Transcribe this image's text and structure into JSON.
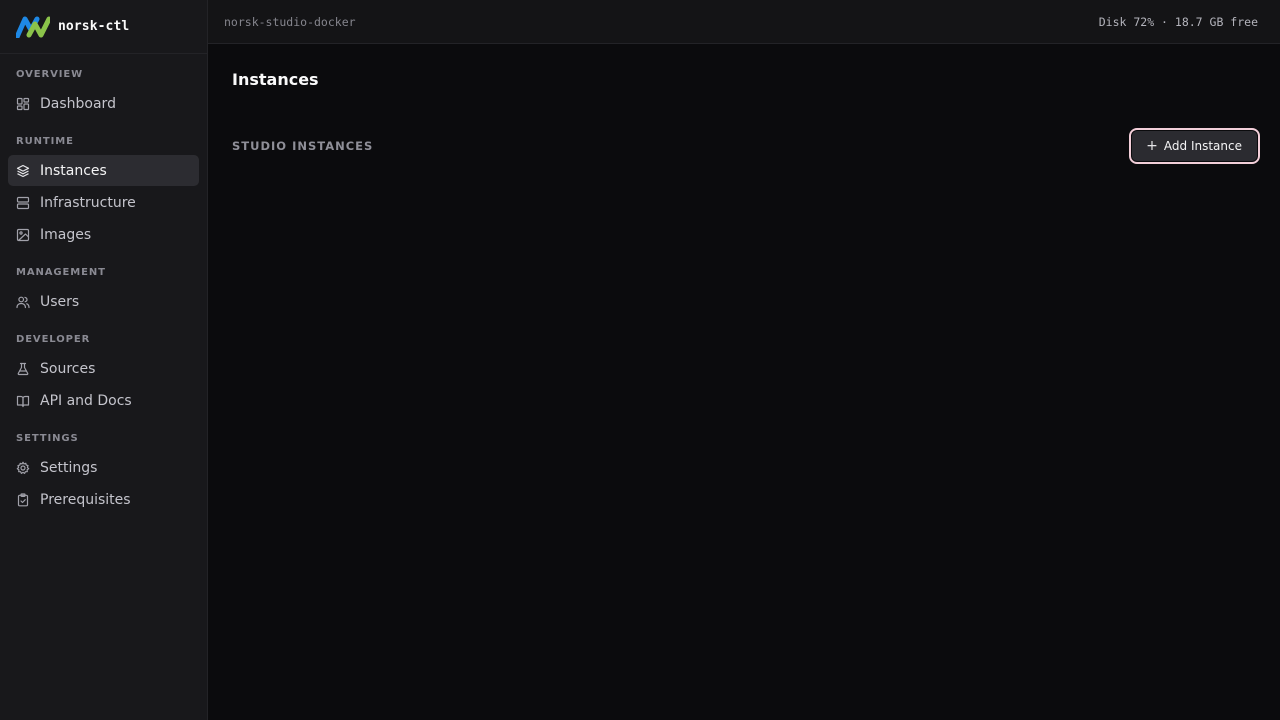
{
  "app": {
    "name": "norsk-ctl"
  },
  "sidebar": {
    "sections": [
      {
        "title": "OVERVIEW",
        "items": [
          {
            "label": "Dashboard",
            "icon": "dashboard-grid-icon",
            "active": false
          }
        ]
      },
      {
        "title": "RUNTIME",
        "items": [
          {
            "label": "Instances",
            "icon": "layers-icon",
            "active": true
          },
          {
            "label": "Infrastructure",
            "icon": "server-icon",
            "active": false
          },
          {
            "label": "Images",
            "icon": "image-icon",
            "active": false
          }
        ]
      },
      {
        "title": "MANAGEMENT",
        "items": [
          {
            "label": "Users",
            "icon": "users-icon",
            "active": false
          }
        ]
      },
      {
        "title": "DEVELOPER",
        "items": [
          {
            "label": "Sources",
            "icon": "flask-icon",
            "active": false
          },
          {
            "label": "API and Docs",
            "icon": "book-icon",
            "active": false
          }
        ]
      },
      {
        "title": "SETTINGS",
        "items": [
          {
            "label": "Settings",
            "icon": "gear-icon",
            "active": false
          },
          {
            "label": "Prerequisites",
            "icon": "clipboard-check-icon",
            "active": false
          }
        ]
      }
    ]
  },
  "topbar": {
    "host": "norsk-studio-docker",
    "disk_status": "Disk 72% · 18.7 GB free"
  },
  "main": {
    "page_title": "Instances",
    "list_title": "STUDIO INSTANCES",
    "add_button_label": "Add Instance"
  },
  "colors": {
    "logo_blue": "#1e88e5",
    "logo_green": "#8bc34a",
    "focus_ring": "#f3cfd9"
  }
}
